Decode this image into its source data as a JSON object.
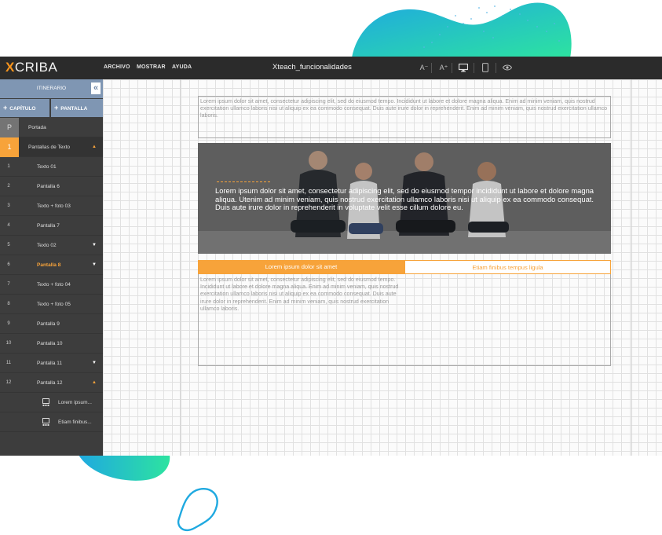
{
  "app": {
    "logo_x": "X",
    "logo_rest": "CRIBA",
    "menu": [
      "ARCHIVO",
      "MOSTRAR",
      "AYUDA"
    ],
    "document_title": "Xteach_funcionalidades",
    "toolbar": {
      "font_down_label": "A⁻",
      "font_up_label": "A⁺",
      "icons": [
        "font-decrease-icon",
        "font-increase-icon",
        "desktop-icon",
        "mobile-icon",
        "preview-eye-icon"
      ]
    }
  },
  "sidebar": {
    "header": "ITINERARIO",
    "add_capitulo": "CAPÍTULO",
    "add_pantalla": "PANTALLA",
    "portada": {
      "badge": "P",
      "label": "Portada"
    },
    "chapter": {
      "badge": "1",
      "label": "Pantallas de Texto"
    },
    "items": [
      {
        "num": "1",
        "label": "Texto 01"
      },
      {
        "num": "2",
        "label": "Pantalla 6"
      },
      {
        "num": "3",
        "label": "Texto + foto 03"
      },
      {
        "num": "4",
        "label": "Pantalla 7"
      },
      {
        "num": "5",
        "label": "Texto 02"
      },
      {
        "num": "6",
        "label": "Pantalla 8"
      },
      {
        "num": "7",
        "label": "Texto + foto 04"
      },
      {
        "num": "8",
        "label": "Texto + foto 05"
      },
      {
        "num": "9",
        "label": "Pantalla 9"
      },
      {
        "num": "10",
        "label": "Pantalla 10"
      },
      {
        "num": "11",
        "label": "Pantalla 11"
      },
      {
        "num": "12",
        "label": "Pantalla 12"
      }
    ],
    "sub_items": [
      {
        "label": "Lorem ipsum..."
      },
      {
        "label": "Etiam finibus..."
      }
    ],
    "active_item": "Pantalla 8"
  },
  "content": {
    "text_block": "Lorem ipsum dolor sit amet, consectetur adipiscing elit, sed do eiusmod tempo. Incididunt ut labore et dolore magna aliqua. Enim ad minim veniam, quis nostrud exercitation ullamco laboris nisi ut aliquip ex ea commodo consequat. Duis aute irure dolor in reprehenderit. Enim ad minim veniam, quis nostrud exercitation ullamco laboris.",
    "hero_text": "Lorem ipsum dolor sit amet, consectetur adipiscing elit, sed do eiusmod tempor incididunt ut labore et dolore magna aliqua. Utenim ad minim veniam, quis nostrud exercitation ullamco laboris nisi ut aliquip ex ea commodo consequat. Duis aute irure dolor in reprehenderit in voluptate velit esse cillum dolore eu.",
    "tabs": [
      {
        "label": "Lorem ipsum dolor sit amet",
        "active": true
      },
      {
        "label": "Etiam finibus tempus ligula",
        "active": false
      }
    ],
    "tab_body": "Lorem ipsum dolor sit amet, consectetur adipiscing elit, sed do eiusmod tempo. Incididunt ut labore et dolore magna aliqua. Enim ad minim veniam, quis nostrud exercitation ullamco laboris nisi ut aliquip ex ea commodo consequat. Duis aute irure dolor in reprehenderit. Enim ad minim veniam, quis nostrud exercitation ullamco laboris."
  },
  "colors": {
    "accent": "#f7a33a",
    "topbar": "#2b2b2b",
    "sidebar": "#3d3d3d",
    "sidebar_header": "#7f96b3",
    "blob_gradient_start": "#1fa9e0",
    "blob_gradient_end": "#2de3a0"
  }
}
